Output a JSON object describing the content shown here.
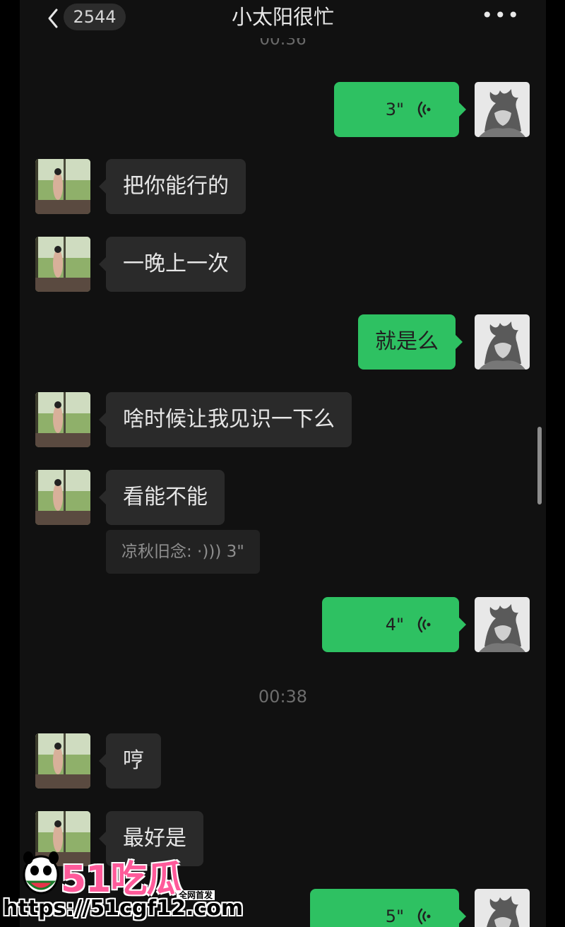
{
  "header": {
    "title": "小太阳很忙",
    "unread_count": "2544",
    "more_icon": "more-dots-icon",
    "back_icon": "chevron-left-icon"
  },
  "top_time": "00:36",
  "messages": [
    {
      "side": "out",
      "type": "voice",
      "duration": "3\""
    },
    {
      "side": "in",
      "type": "text",
      "text": "把你能行的"
    },
    {
      "side": "in",
      "type": "text",
      "text": "一晚上一次"
    },
    {
      "side": "out",
      "type": "text",
      "text": "就是么"
    },
    {
      "side": "in",
      "type": "text",
      "text": "啥时候让我见识一下么"
    },
    {
      "side": "in",
      "type": "text",
      "text": "看能不能"
    },
    {
      "side": "in",
      "type": "quote",
      "text": "凉秋旧念: ·))) 3\""
    },
    {
      "side": "out",
      "type": "voice",
      "duration": "4\""
    },
    {
      "side": "in",
      "type": "text",
      "text": "哼"
    },
    {
      "side": "in",
      "type": "text",
      "text": "最好是"
    },
    {
      "side": "out",
      "type": "voice",
      "duration": "5\""
    }
  ],
  "mid_time": "00:38",
  "watermark": {
    "logo": "51吃瓜",
    "tag": "全网首发",
    "url": "https://51cgf12.com"
  },
  "colors": {
    "background": "#111111",
    "incoming_bubble": "#2a2a2a",
    "outgoing_bubble": "#2ec162",
    "watermark_pink": "#ff5a9a"
  }
}
